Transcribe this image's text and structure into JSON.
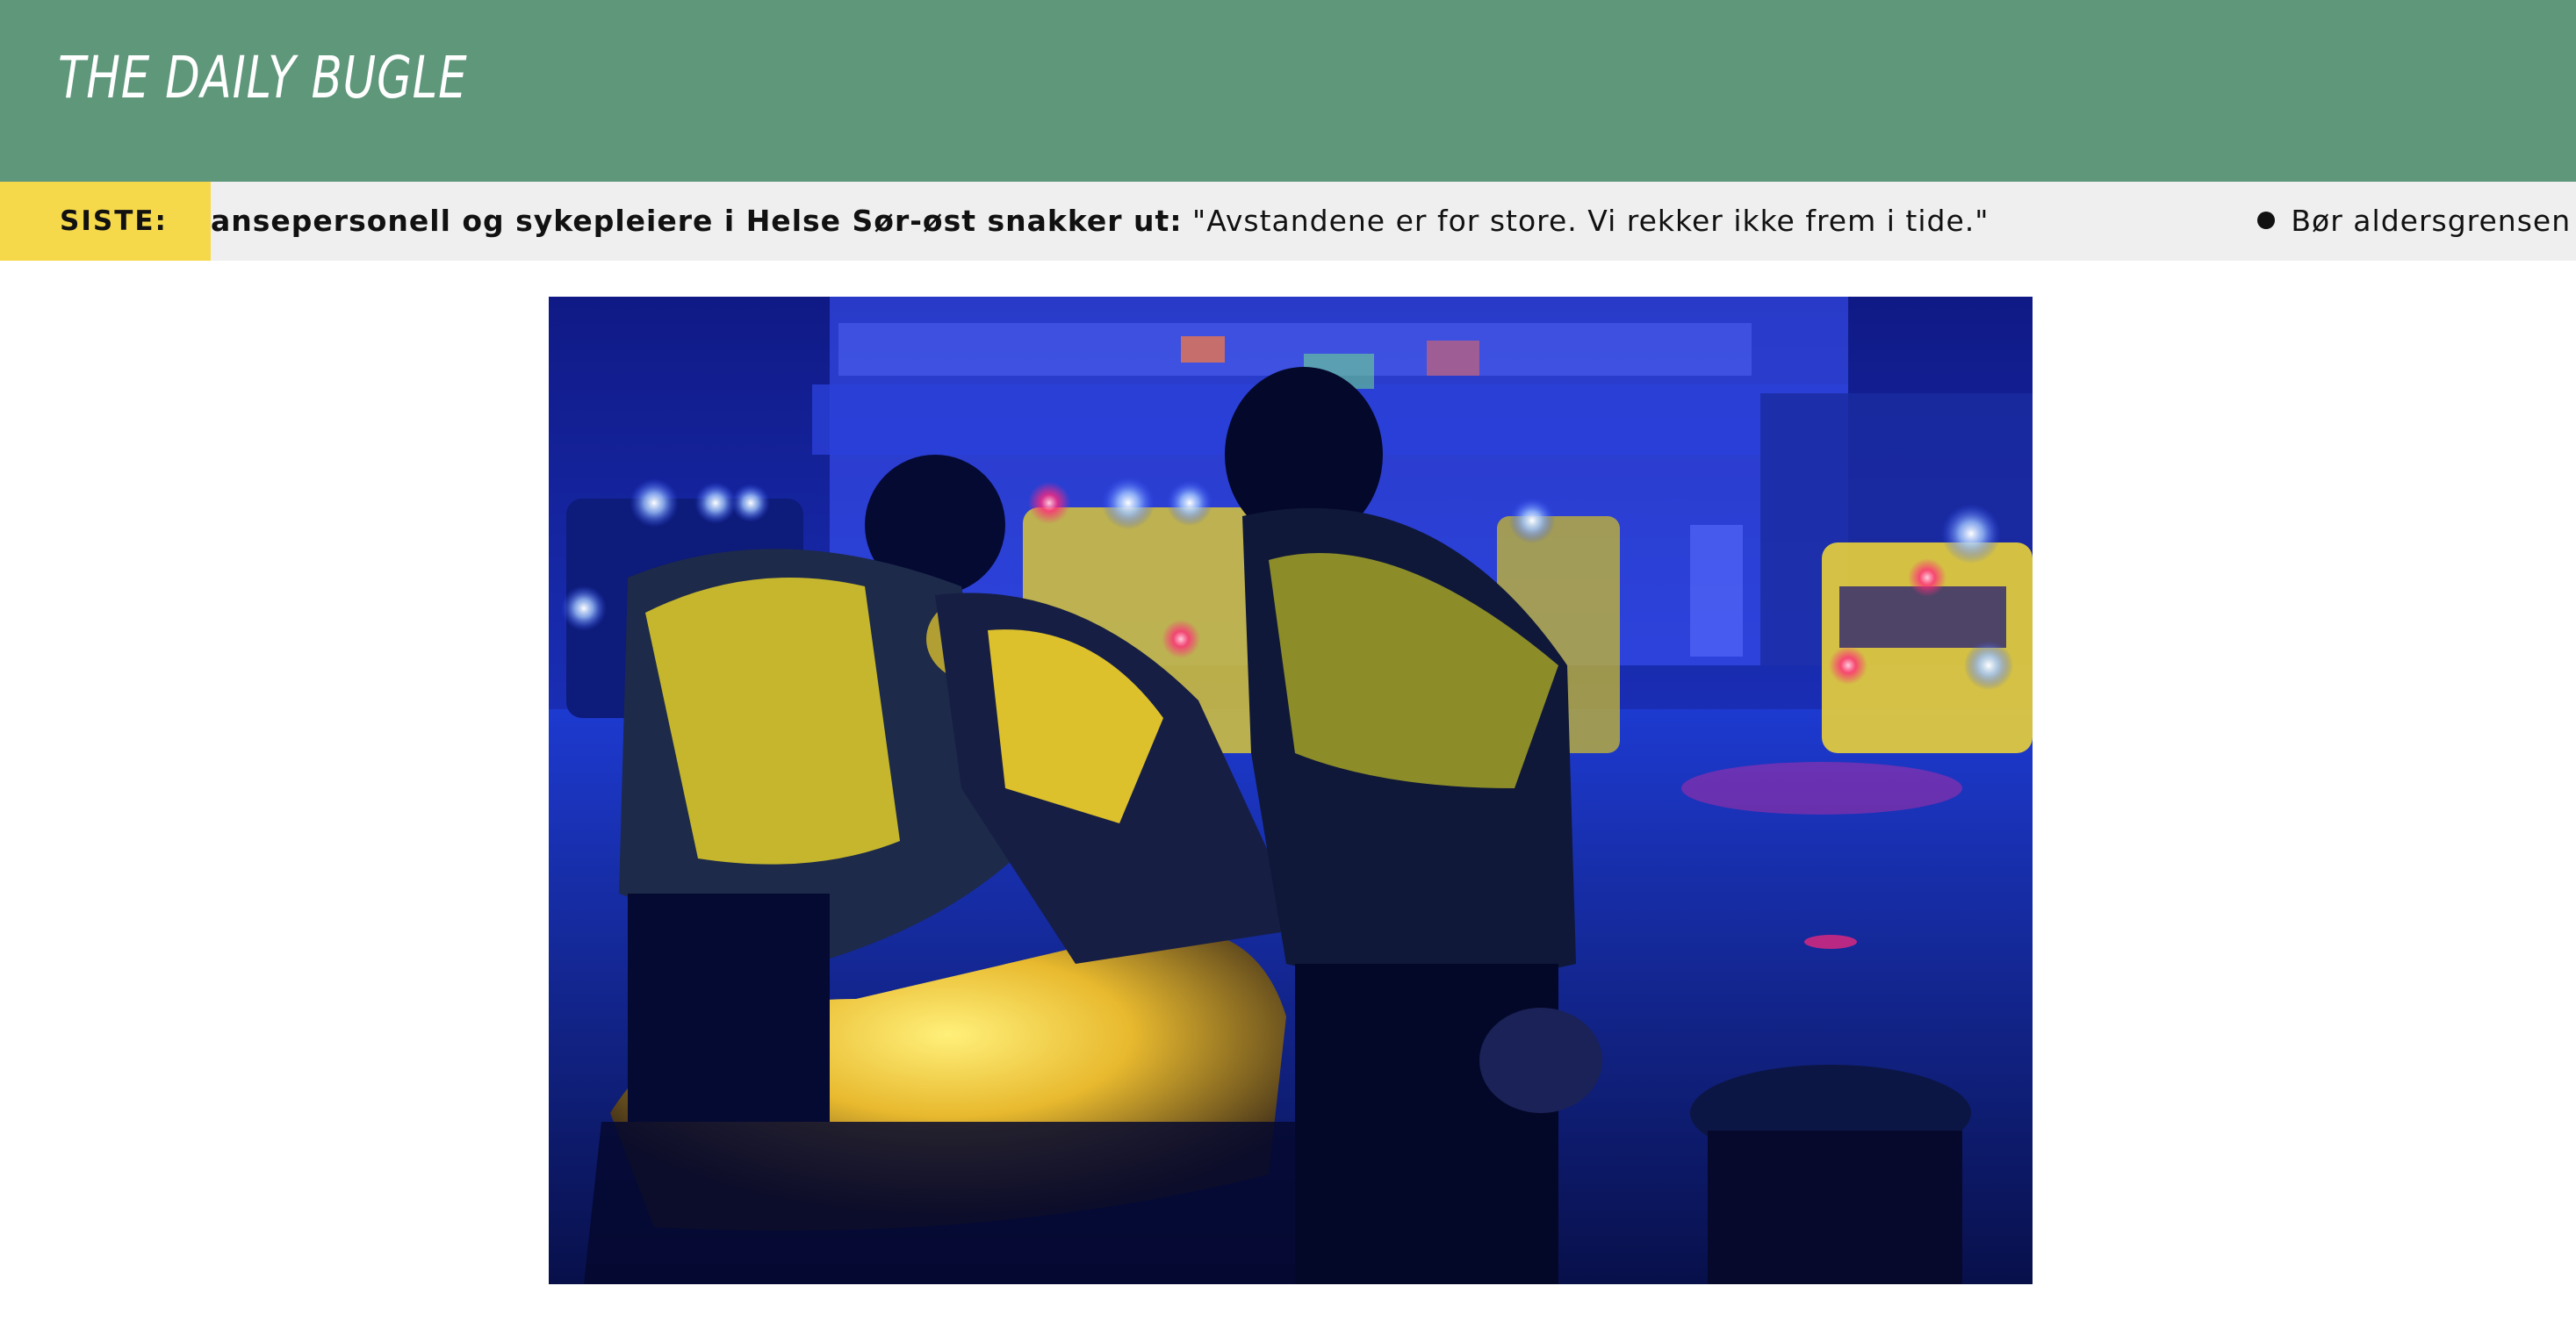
{
  "header": {
    "site_title": "THE DAILY BUGLE"
  },
  "ticker": {
    "badge_label": "SISTE:",
    "items": [
      {
        "headline_bold": "anseperso­nell og sykepleiere i Helse Sør-øst snakker ut:",
        "quote": " \"Avstandene er for store. Vi rekker ikke frem i tide.\""
      },
      {
        "headline_bold": "",
        "quote": "Bør aldersgrensen på le"
      }
    ]
  },
  "hero_image": {
    "alt": "",
    "colors": {
      "night_blue": "#0a1370",
      "jacket_yellow": "#f2d22a",
      "blanket_gold": "#e8b92e"
    }
  }
}
